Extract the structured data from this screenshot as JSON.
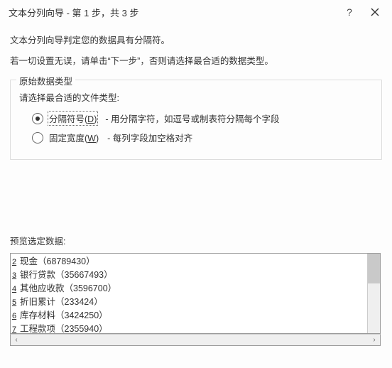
{
  "titlebar": {
    "title": "文本分列向导 - 第 1 步，共 3 步",
    "help_label": "?",
    "close_label": "×"
  },
  "intro": {
    "line1": "文本分列向导判定您的数据具有分隔符。",
    "line2": "若一切设置无误，请单击“下一步”，否则请选择最合适的数据类型。"
  },
  "group": {
    "legend": "原始数据类型",
    "prompt": "请选择最合适的文件类型:",
    "options": [
      {
        "label_prefix": "分隔符号(",
        "hotkey": "D",
        "label_suffix": ")",
        "desc": "- 用分隔字符，如逗号或制表符分隔每个字段",
        "selected": true
      },
      {
        "label_prefix": "固定宽度(",
        "hotkey": "W",
        "label_suffix": ")",
        "desc": "- 每列字段加空格对齐",
        "selected": false
      }
    ]
  },
  "preview": {
    "label": "预览选定数据:",
    "rows": [
      {
        "n": "2",
        "text": "现金（68789430）"
      },
      {
        "n": "3",
        "text": "银行贷款（35667493）"
      },
      {
        "n": "4",
        "text": "其他应收款（3596700）"
      },
      {
        "n": "5",
        "text": "折旧累计（233424）"
      },
      {
        "n": "6",
        "text": "库存材料（3424250）"
      },
      {
        "n": "7",
        "text": "工程款项（2355940）"
      }
    ],
    "hscroll_left": "‹",
    "hscroll_right": "›"
  }
}
